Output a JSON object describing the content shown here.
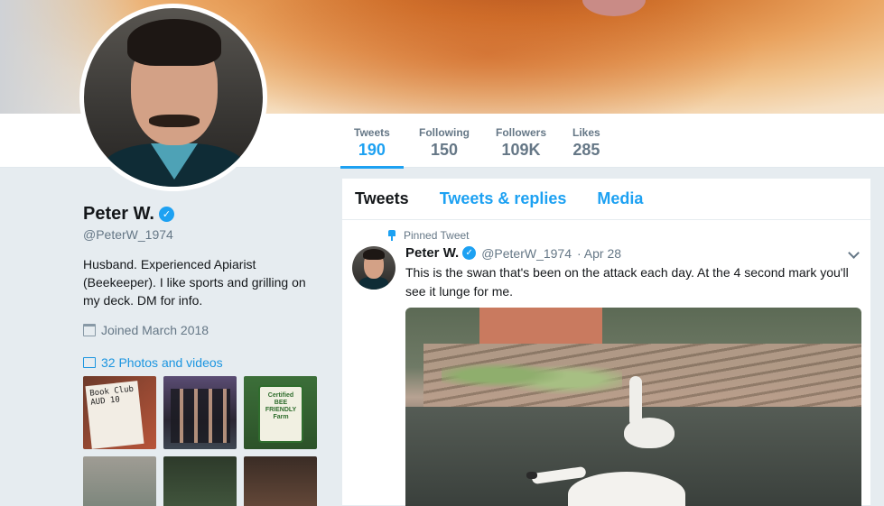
{
  "profile": {
    "name": "Peter W.",
    "verified_mark": "✓",
    "handle": "@PeterW_1974",
    "bio": "Husband. Experienced Apiarist (Beekeeper). I like sports and grilling on my deck. DM for info.",
    "joined": "Joined March 2018",
    "photos_link": "32 Photos and videos"
  },
  "stats": [
    {
      "label": "Tweets",
      "value": "190"
    },
    {
      "label": "Following",
      "value": "150"
    },
    {
      "label": "Followers",
      "value": "109K"
    },
    {
      "label": "Likes",
      "value": "285"
    }
  ],
  "thumbs": {
    "ticket_text": "Book Club\nAUD 10",
    "sign_text": "Certified\nBEE FRIENDLY\nFarm"
  },
  "timeline": {
    "tabs": [
      "Tweets",
      "Tweets & replies",
      "Media"
    ]
  },
  "tweet": {
    "pinned_label": "Pinned Tweet",
    "author": "Peter W.",
    "handle": "@PeterW_1974",
    "date": "· Apr 28",
    "text": "This is the swan that's been on the attack each day. At the 4 second mark you'll see it lunge for me."
  },
  "colors": {
    "accent": "#1da1f2",
    "link": "#1b95e0",
    "muted": "#657786",
    "page_bg": "#e6ecf0"
  },
  "icons": [
    "verified-badge-icon",
    "calendar-icon",
    "photo-icon",
    "pin-icon",
    "chevron-down-icon"
  ]
}
